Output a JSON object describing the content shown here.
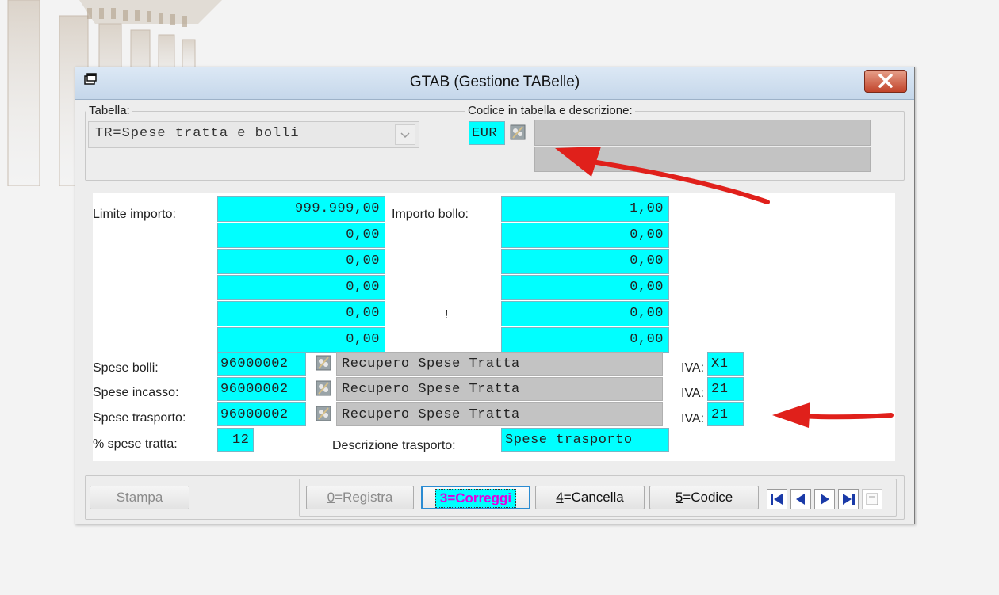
{
  "window": {
    "title": "GTAB (Gestione TABelle)"
  },
  "header": {
    "tabella_label": "Tabella:",
    "tabella_value": "TR=Spese tratta e bolli",
    "codice_label": "Codice in tabella e descrizione:",
    "codice_value": "EUR",
    "descr_line1": "",
    "descr_line2": ""
  },
  "form": {
    "limite_label": "Limite importo:",
    "bollo_label": "Importo bollo:",
    "limiti": [
      "999.999,00",
      "0,00",
      "0,00",
      "0,00",
      "0,00",
      "0,00"
    ],
    "bolli": [
      "1,00",
      "0,00",
      "0,00",
      "0,00",
      "0,00",
      "0,00"
    ],
    "exclamation": "!",
    "spese": [
      {
        "label": "Spese bolli:",
        "code": "96000002",
        "descr": "Recupero Spese Tratta",
        "iva_label": "IVA:",
        "iva": "X1"
      },
      {
        "label": "Spese incasso:",
        "code": "96000002",
        "descr": "Recupero Spese Tratta",
        "iva_label": "IVA:",
        "iva": "21"
      },
      {
        "label": "Spese trasporto:",
        "code": "96000002",
        "descr": "Recupero Spese Tratta",
        "iva_label": "IVA:",
        "iva": "21"
      }
    ],
    "perc_label": "% spese tratta:",
    "perc_value": "12",
    "descr_trasp_label": "Descrizione trasporto:",
    "descr_trasp_value": "Spese trasporto"
  },
  "buttons": {
    "stampa": "Stampa",
    "registra_key": "0",
    "registra_rest": "=Registra",
    "correggi": "3=Correggi",
    "cancella_key": "4",
    "cancella_rest": "=Cancella",
    "codice_key": "5",
    "codice_rest": "=Codice"
  },
  "colors": {
    "input_cyan": "#00ffff",
    "annotation_arrow": "#e0201b",
    "highlight_text": "#e000e0"
  },
  "icons": [
    "app-window-icon",
    "close-icon",
    "lookup-icon",
    "first-record-icon",
    "previous-record-icon",
    "next-record-icon",
    "last-record-icon",
    "note-icon"
  ]
}
